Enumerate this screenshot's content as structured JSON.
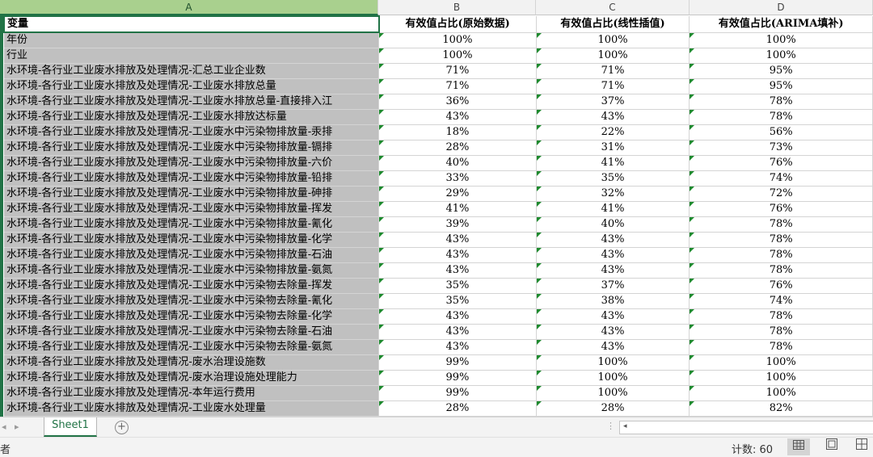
{
  "sheet": {
    "columns": [
      "A",
      "B",
      "C",
      "D"
    ],
    "header": [
      "变量",
      "有效值占比(原始数据)",
      "有效值占比(线性插值)",
      "有效值占比(ARIMA填补)"
    ],
    "rows": [
      [
        "年份",
        "100%",
        "100%",
        "100%"
      ],
      [
        "行业",
        "100%",
        "100%",
        "100%"
      ],
      [
        "水环境-各行业工业废水排放及处理情况-汇总工业企业数",
        "71%",
        "71%",
        "95%"
      ],
      [
        "水环境-各行业工业废水排放及处理情况-工业废水排放总量",
        "71%",
        "71%",
        "95%"
      ],
      [
        "水环境-各行业工业废水排放及处理情况-工业废水排放总量-直接排入江",
        "36%",
        "37%",
        "78%"
      ],
      [
        "水环境-各行业工业废水排放及处理情况-工业废水排放达标量",
        "43%",
        "43%",
        "78%"
      ],
      [
        "水环境-各行业工业废水排放及处理情况-工业废水中污染物排放量-汞排",
        "18%",
        "22%",
        "56%"
      ],
      [
        "水环境-各行业工业废水排放及处理情况-工业废水中污染物排放量-镉排",
        "28%",
        "31%",
        "73%"
      ],
      [
        "水环境-各行业工业废水排放及处理情况-工业废水中污染物排放量-六价",
        "40%",
        "41%",
        "76%"
      ],
      [
        "水环境-各行业工业废水排放及处理情况-工业废水中污染物排放量-铅排",
        "33%",
        "35%",
        "74%"
      ],
      [
        "水环境-各行业工业废水排放及处理情况-工业废水中污染物排放量-砷排",
        "29%",
        "32%",
        "72%"
      ],
      [
        "水环境-各行业工业废水排放及处理情况-工业废水中污染物排放量-挥发",
        "41%",
        "41%",
        "76%"
      ],
      [
        "水环境-各行业工业废水排放及处理情况-工业废水中污染物排放量-氰化",
        "39%",
        "40%",
        "78%"
      ],
      [
        "水环境-各行业工业废水排放及处理情况-工业废水中污染物排放量-化学",
        "43%",
        "43%",
        "78%"
      ],
      [
        "水环境-各行业工业废水排放及处理情况-工业废水中污染物排放量-石油",
        "43%",
        "43%",
        "78%"
      ],
      [
        "水环境-各行业工业废水排放及处理情况-工业废水中污染物排放量-氨氮",
        "43%",
        "43%",
        "78%"
      ],
      [
        "水环境-各行业工业废水排放及处理情况-工业废水中污染物去除量-挥发",
        "35%",
        "37%",
        "76%"
      ],
      [
        "水环境-各行业工业废水排放及处理情况-工业废水中污染物去除量-氰化",
        "35%",
        "38%",
        "74%"
      ],
      [
        "水环境-各行业工业废水排放及处理情况-工业废水中污染物去除量-化学",
        "43%",
        "43%",
        "78%"
      ],
      [
        "水环境-各行业工业废水排放及处理情况-工业废水中污染物去除量-石油",
        "43%",
        "43%",
        "78%"
      ],
      [
        "水环境-各行业工业废水排放及处理情况-工业废水中污染物去除量-氨氮",
        "43%",
        "43%",
        "78%"
      ],
      [
        "水环境-各行业工业废水排放及处理情况-废水治理设施数",
        "99%",
        "100%",
        "100%"
      ],
      [
        "水环境-各行业工业废水排放及处理情况-废水治理设施处理能力",
        "99%",
        "100%",
        "100%"
      ],
      [
        "水环境-各行业工业废水排放及处理情况-本年运行费用",
        "99%",
        "100%",
        "100%"
      ],
      [
        "水环境-各行业工业废水排放及处理情况-工业废水处理量",
        "28%",
        "28%",
        "82%"
      ]
    ]
  },
  "tabs": {
    "active_sheet": "Sheet1",
    "add_symbol": "+",
    "nav_prev": "◂",
    "nav_next": "▸",
    "scroll_left": "◂",
    "split_dots": "⋮"
  },
  "status": {
    "left_text": "者",
    "count_label": "计数: 60"
  },
  "icons": {
    "normal_view": "normal-view-icon",
    "page_layout": "page-layout-icon",
    "page_break": "page-break-preview-icon"
  },
  "colors": {
    "accent": "#217346",
    "selected_col_header": "#a9d08e",
    "selection_fill": "#c0c0c0",
    "error_triangle": "#1e8a2e"
  }
}
